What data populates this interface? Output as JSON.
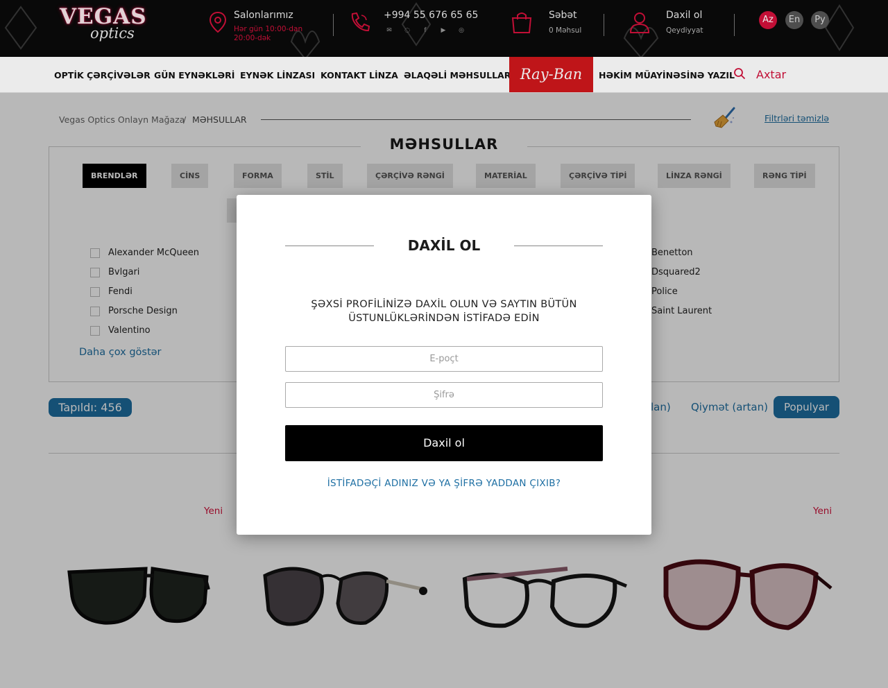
{
  "topbar": {
    "logo_main": "VEGAS",
    "logo_sub": "optics",
    "salons_title": "Salonlarımız",
    "salons_hours": "Hər gün 10:00-dan 20:00-dək",
    "phone": "+994 55 676 65 65",
    "cart_title": "Səbət",
    "cart_count": "0 Məhsul",
    "login_title": "Daxil ol",
    "register": "Qeydiyyat",
    "languages": [
      "Az",
      "En",
      "Ру"
    ],
    "active_language": "Az"
  },
  "nav": {
    "items": [
      "OPTİK ÇƏRÇİVƏLƏR",
      "GÜN EYNƏKLƏRİ",
      "EYNƏK LİNZASI",
      "KONTAKT LİNZA",
      "ƏLAQƏLİ MƏHSULLAR"
    ],
    "rayban": "Ray-Ban",
    "doctor": "HƏKİM MÜAYİNƏSİNƏ YAZIL",
    "search": "Axtar"
  },
  "breadcrumb": {
    "home": "Vegas Optics Onlayn Mağaza",
    "separator": "/",
    "current": "MƏHSULLAR"
  },
  "clear_filters": "Filtrləri təmizlə",
  "page_title": "MƏHSULLAR",
  "filter_tabs": [
    "BRENDLƏR",
    "CİNS",
    "FORMA",
    "STİL",
    "ÇƏRÇİVƏ RƏNGİ",
    "MATERİAL",
    "ÇƏRÇİVƏ TİPİ",
    "LİNZA RƏNGİ",
    "RƏNG TİPİ"
  ],
  "brands_left": [
    "Alexander McQueen",
    "Bvlgari",
    "Fendi",
    "Porsche Design",
    "Valentino"
  ],
  "brands_right": [
    "Benetton",
    "Dsquared2",
    "Police",
    "Saint Laurent"
  ],
  "show_more": "Daha çox göstər",
  "found": "Tapıldı: 456",
  "sort": {
    "partial": "lan)",
    "price_asc": "Qiymət (artan)",
    "popular": "Populyar"
  },
  "products": {
    "new_badge": "Yeni"
  },
  "modal": {
    "title": "DAXİL OL",
    "subtitle": "ŞƏXSİ PROFİLİNİZƏ DAXİL OLUN VƏ SAYTIN BÜTÜN ÜSTUNLÜKLƏRİNDƏN İSTİFADƏ EDİN",
    "email_placeholder": "E-poçt",
    "password_placeholder": "Şifrə",
    "submit": "Daxil ol",
    "forgot": "İSTİFADƏÇİ ADINIZ VƏ YA ŞİFRƏ YADDAN ÇIXIB?"
  },
  "colors": {
    "accent_red": "#d2113b",
    "link_blue": "#1e6fa3",
    "rayban_red": "#d0171c"
  }
}
